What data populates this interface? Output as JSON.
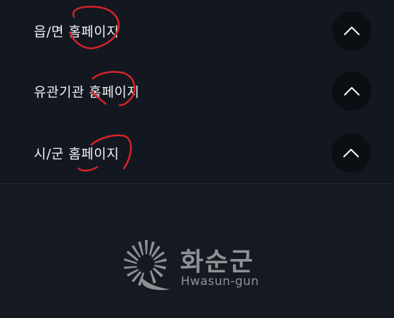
{
  "menu": {
    "items": [
      {
        "label": "읍/면 홈페이지",
        "toggle_icon": "chevron-up-icon"
      },
      {
        "label": "유관기관 홈페이지",
        "toggle_icon": "chevron-up-icon"
      },
      {
        "label": "시/군 홈페이지",
        "toggle_icon": "chevron-up-icon"
      }
    ]
  },
  "footer": {
    "logo_text": "화순군",
    "logo_subtext": "Hwasun-gun",
    "logo_icon": "sunflower-emblem-icon"
  },
  "colors": {
    "background": "#151a21",
    "toggle_bg": "#0b0e12",
    "text": "#f2f3f5",
    "logo": "#8e9296",
    "annotation": "#d8232a"
  }
}
